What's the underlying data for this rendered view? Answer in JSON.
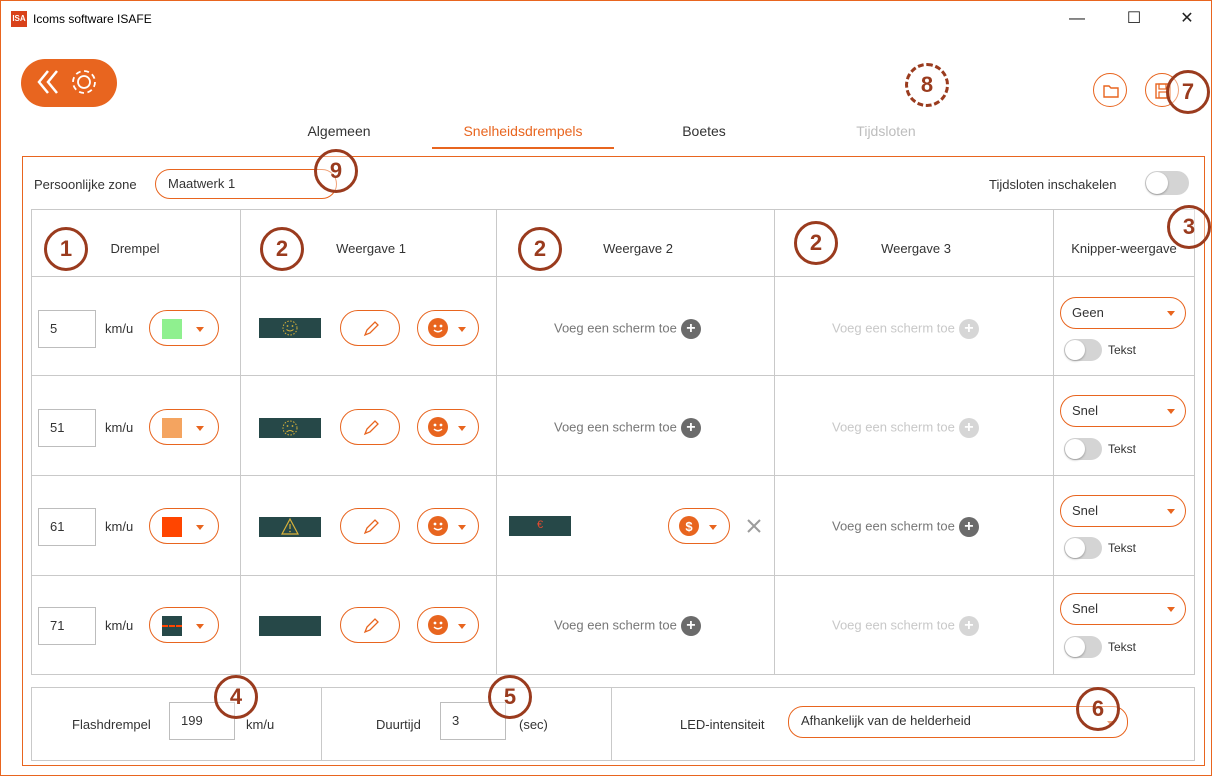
{
  "window": {
    "title": "Icoms software ISAFE",
    "app_icon_text": "ISA",
    "minimize": "—",
    "maximize": "☐",
    "close": "✕"
  },
  "tabs": [
    {
      "label": "Algemeen",
      "active": false,
      "disabled": false
    },
    {
      "label": "Snelheidsdrempels",
      "active": true,
      "disabled": false
    },
    {
      "label": "Boetes",
      "active": false,
      "disabled": false
    },
    {
      "label": "Tijdsloten",
      "active": false,
      "disabled": true
    }
  ],
  "zone": {
    "label": "Persoonlijke zone",
    "value": "Maatwerk 1"
  },
  "timeslots_toggle": {
    "label": "Tijdsloten inschakelen",
    "on": false
  },
  "columns": [
    "Drempel",
    "Weergave 1",
    "Weergave 2",
    "Weergave 3",
    "Knipper-weergave"
  ],
  "unit": "km/u",
  "add_screen_label": "Voeg een scherm toe",
  "tekst_label": "Tekst",
  "rows": [
    {
      "threshold": "5",
      "color": "#8ff08f",
      "display1": "smiley-happy",
      "display2": null,
      "display3_muted": true,
      "blink": "Geen"
    },
    {
      "threshold": "51",
      "color": "#f4a460",
      "display1": "smiley-sad",
      "display2": null,
      "display3_muted": true,
      "blink": "Snel"
    },
    {
      "threshold": "61",
      "color": "#ff4500",
      "display1": "warning",
      "display2": "€",
      "display3_muted": false,
      "blink": "Snel"
    },
    {
      "threshold": "71",
      "color": "#264848",
      "display1": "blank",
      "display2": null,
      "display3_muted": true,
      "blink": "Snel"
    }
  ],
  "bottom": {
    "flash_label": "Flashdrempel",
    "flash_value": "199",
    "flash_unit": "km/u",
    "duration_label": "Duurtijd",
    "duration_value": "3",
    "duration_unit": "(sec)",
    "led_label": "LED-intensiteit",
    "led_value": "Afhankelijk van de helderheid"
  },
  "callouts": [
    "1",
    "2",
    "2",
    "2",
    "3",
    "4",
    "5",
    "6",
    "7",
    "8",
    "9"
  ],
  "accent": "#e8651f",
  "callout_color": "#9a3b1e"
}
